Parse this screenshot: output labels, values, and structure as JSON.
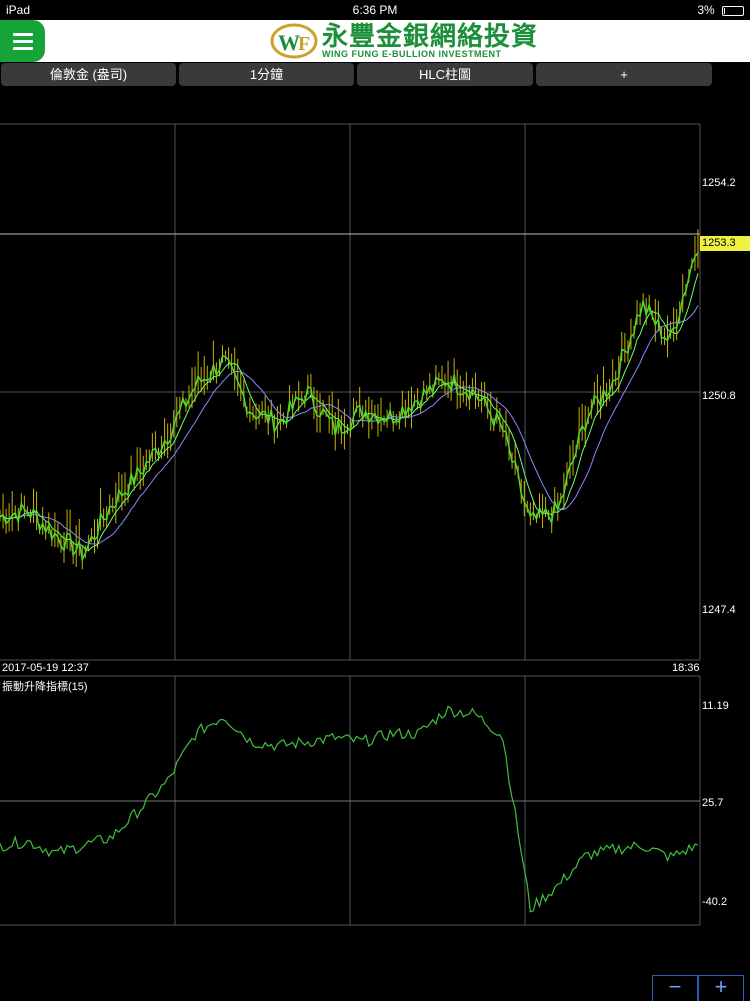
{
  "status": {
    "device": "iPad",
    "time": "6:36 PM",
    "battery": "3%"
  },
  "header": {
    "logo_cn": "永豐金銀網絡投資",
    "logo_en": "WING FUNG E-BULLION INVESTMENT"
  },
  "tabs": [
    {
      "label": "倫敦金 (盎司)"
    },
    {
      "label": "1分鐘"
    },
    {
      "label": "HLC柱圖"
    },
    {
      "label": "+"
    }
  ],
  "colors": {
    "accent_green": "#16a33a",
    "price_line": "#4cd936",
    "bar": "#c8b400",
    "ma_short": "#6cff6c",
    "ma_long": "#8888ff",
    "current_price_bg": "#f0f040"
  },
  "chart_data": [
    {
      "type": "line",
      "chart": "price",
      "x_start": "2017-05-19 12:37",
      "x_end": "18:36",
      "y_ticks": [
        "1254.2",
        "1250.8",
        "1247.4"
      ],
      "current_price": "1253.3",
      "ylim": [
        1246.6,
        1255.2
      ],
      "x": [
        0,
        4,
        8,
        12,
        16,
        20,
        24,
        28,
        32,
        36,
        40,
        44,
        48,
        52,
        56,
        60,
        64,
        68,
        72,
        76,
        80,
        84,
        88,
        92,
        96,
        100
      ],
      "values": [
        1248.9,
        1249.0,
        1248.6,
        1248.3,
        1249.1,
        1249.6,
        1250.2,
        1251.0,
        1251.4,
        1250.6,
        1250.4,
        1250.9,
        1250.3,
        1250.6,
        1250.5,
        1250.8,
        1251.1,
        1250.9,
        1250.3,
        1248.8,
        1249.0,
        1250.5,
        1251.1,
        1252.3,
        1251.7,
        1253.3
      ]
    },
    {
      "type": "line",
      "chart": "indicator",
      "title": "振動升降指標(15)",
      "y_ticks": [
        "11.19",
        "25.7",
        "-40.2"
      ],
      "x": [
        0,
        4,
        8,
        12,
        16,
        20,
        24,
        28,
        32,
        36,
        40,
        44,
        48,
        52,
        56,
        60,
        64,
        68,
        72,
        76,
        80,
        84,
        88,
        92,
        96,
        100
      ],
      "values": [
        0.3,
        0.32,
        0.26,
        0.3,
        0.34,
        0.48,
        0.62,
        0.86,
        0.95,
        0.82,
        0.8,
        0.82,
        0.84,
        0.82,
        0.86,
        0.86,
        0.98,
        0.96,
        0.85,
        -0.02,
        0.1,
        0.25,
        0.28,
        0.3,
        0.24,
        0.3
      ]
    }
  ],
  "zoom": {
    "minus": "−",
    "plus": "+"
  }
}
